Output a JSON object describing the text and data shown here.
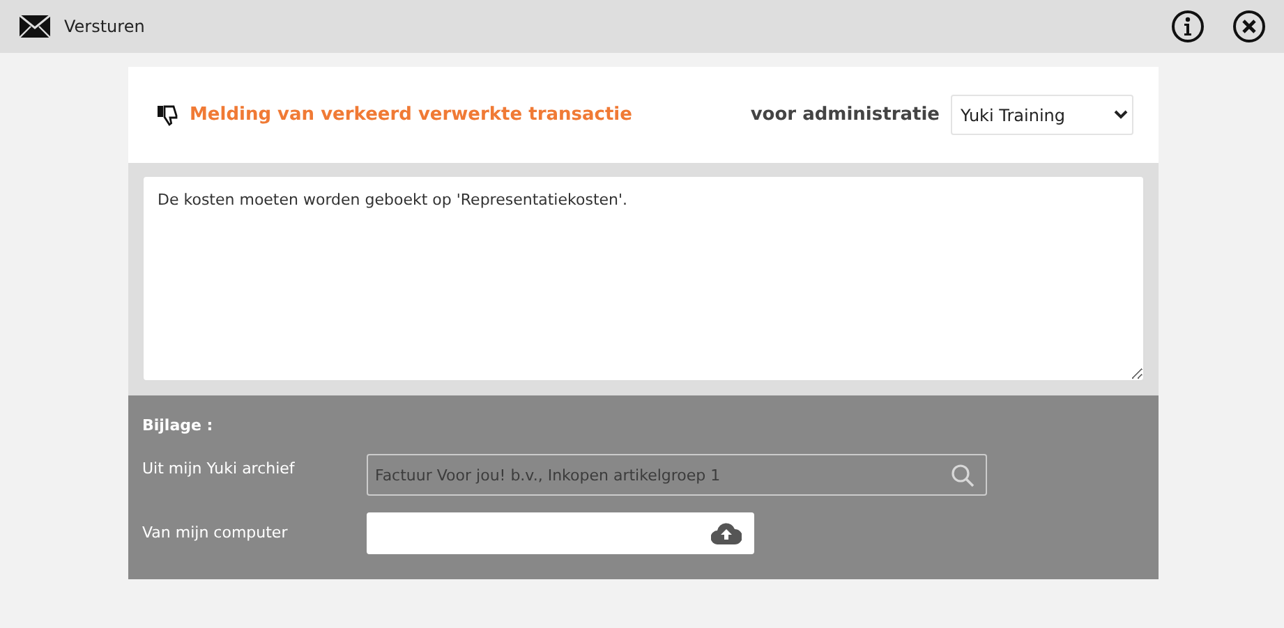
{
  "window": {
    "title": "Versturen"
  },
  "form": {
    "title": "Melding van verkeerd verwerkte transactie",
    "administration_label": "voor administratie",
    "administration": "Yuki Training",
    "message": "De kosten moeten worden geboekt op 'Representatiekosten'."
  },
  "attachment": {
    "heading": "Bijlage :",
    "archive_label": "Uit mijn Yuki archief",
    "archive_value": "Factuur Voor jou! b.v., Inkopen artikelgroep 1",
    "archive_disabled": true,
    "computer_label": "Van mijn computer"
  }
}
